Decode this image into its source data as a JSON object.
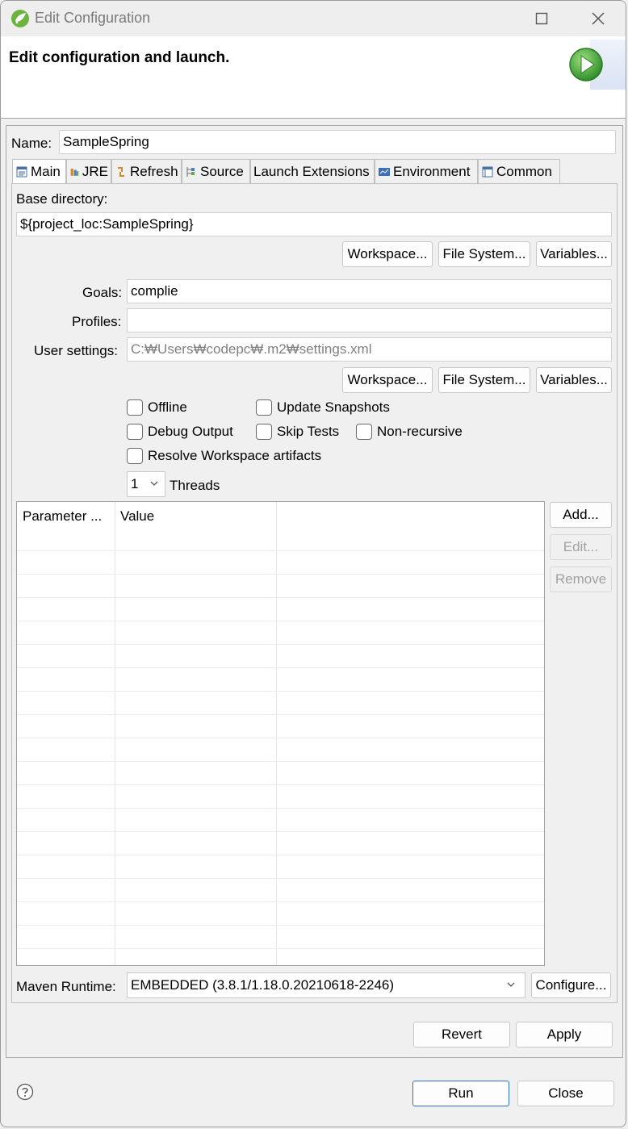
{
  "window": {
    "title": "Edit Configuration"
  },
  "header": {
    "title": "Edit configuration and launch."
  },
  "name_field": {
    "label": "Name:",
    "value": "SampleSpring"
  },
  "tabs": [
    {
      "label": "Main",
      "icon": "main-tab-icon"
    },
    {
      "label": "JRE",
      "icon": "jre-icon"
    },
    {
      "label": "Refresh",
      "icon": "refresh-icon"
    },
    {
      "label": "Source",
      "icon": "source-icon"
    },
    {
      "label": "Launch Extensions",
      "icon": ""
    },
    {
      "label": "Environment",
      "icon": "environment-icon"
    },
    {
      "label": "Common",
      "icon": "common-icon"
    }
  ],
  "main": {
    "base_directory": {
      "label": "Base directory:",
      "value": "${project_loc:SampleSpring}"
    },
    "browse_buttons_1": {
      "workspace": "Workspace...",
      "file_system": "File System...",
      "variables": "Variables..."
    },
    "goals": {
      "label": "Goals:",
      "value": "complie"
    },
    "profiles": {
      "label": "Profiles:",
      "value": ""
    },
    "user_settings": {
      "label": "User settings:",
      "placeholder": "C:₩Users₩codepc₩.m2₩settings.xml"
    },
    "browse_buttons_2": {
      "workspace": "Workspace...",
      "file_system": "File System...",
      "variables": "Variables..."
    },
    "checkboxes": {
      "offline": "Offline",
      "update_snapshots": "Update Snapshots",
      "debug_output": "Debug Output",
      "skip_tests": "Skip Tests",
      "non_recursive": "Non-recursive",
      "resolve_workspace": "Resolve Workspace artifacts"
    },
    "threads": {
      "value": "1",
      "label": "Threads"
    },
    "parameters_table": {
      "columns": [
        "Parameter ...",
        "Value"
      ],
      "rows": []
    },
    "table_buttons": {
      "add": "Add...",
      "edit": "Edit...",
      "remove": "Remove"
    },
    "maven_runtime": {
      "label": "Maven Runtime:",
      "value": "EMBEDDED (3.8.1/1.18.0.20210618-2246)",
      "configure": "Configure..."
    }
  },
  "actions": {
    "revert": "Revert",
    "apply": "Apply"
  },
  "footer": {
    "run": "Run",
    "close": "Close"
  },
  "colors": {
    "accent": "#2e6fc4",
    "run_green": "#3aa935",
    "spring_green": "#6db33f"
  }
}
